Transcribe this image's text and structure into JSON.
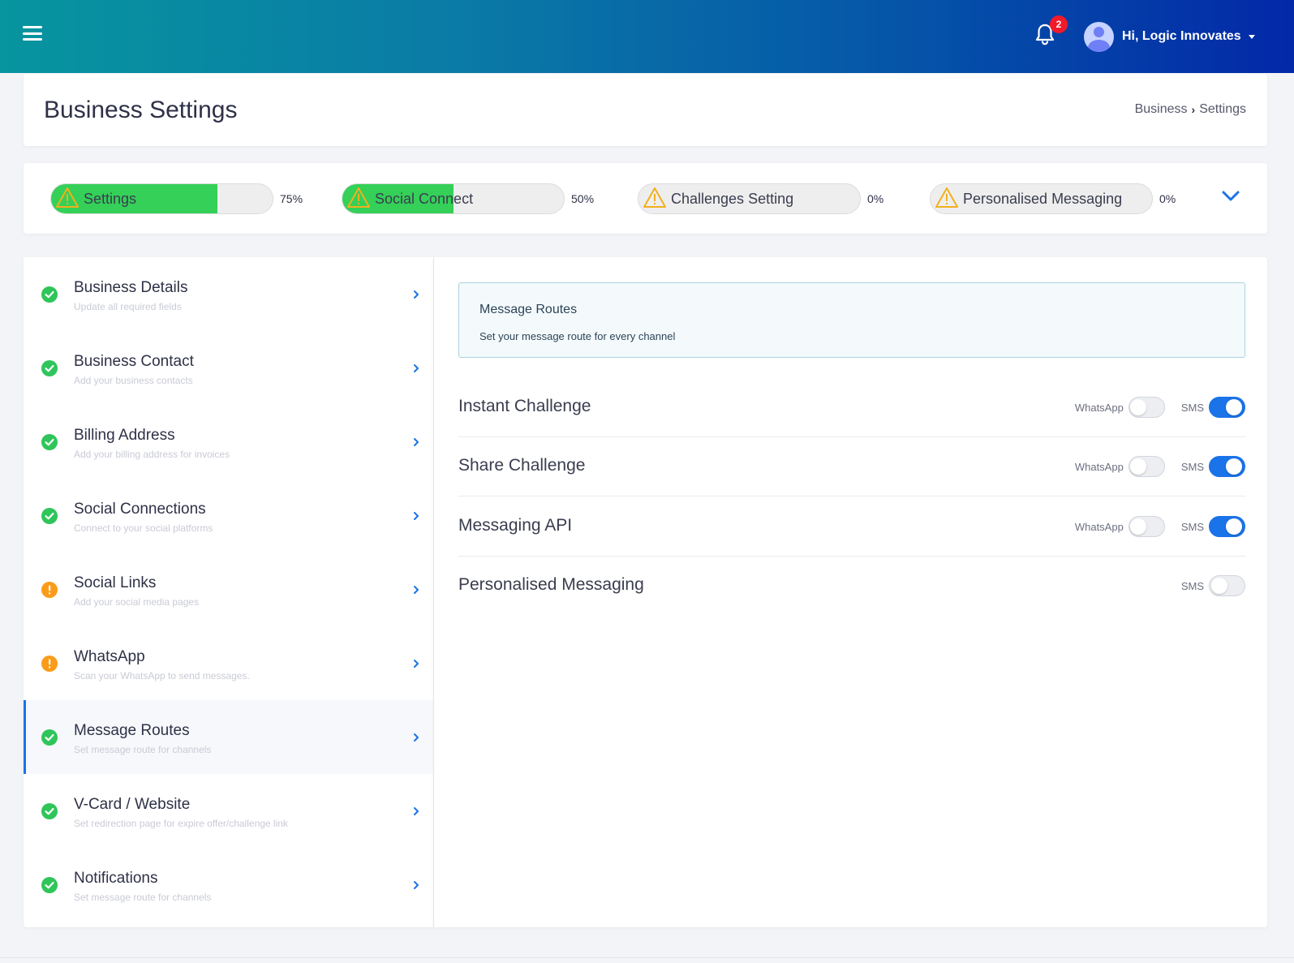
{
  "header": {
    "notification_count": "2",
    "user_greeting": "Hi, Logic Innovates"
  },
  "page": {
    "title": "Business Settings",
    "breadcrumb": [
      "Business",
      "Settings"
    ]
  },
  "progress": [
    {
      "label": "Settings",
      "percent_text": "75%",
      "percent": 75,
      "status": "warning"
    },
    {
      "label": "Social Connect",
      "percent_text": "50%",
      "percent": 50,
      "status": "warning"
    },
    {
      "label": "Challenges Setting",
      "percent_text": "0%",
      "percent": 0,
      "status": "warning"
    },
    {
      "label": "Personalised Messaging",
      "percent_text": "0%",
      "percent": 0,
      "status": "warning"
    }
  ],
  "sidebar": {
    "items": [
      {
        "title": "Business Details",
        "subtitle": "Update all required fields",
        "status": "complete"
      },
      {
        "title": "Business Contact",
        "subtitle": "Add your business contacts",
        "status": "complete"
      },
      {
        "title": "Billing Address",
        "subtitle": "Add your billing address for invoices",
        "status": "complete"
      },
      {
        "title": "Social Connections",
        "subtitle": "Connect to your social platforms",
        "status": "complete"
      },
      {
        "title": "Social Links",
        "subtitle": "Add your social media pages",
        "status": "incomplete"
      },
      {
        "title": "WhatsApp",
        "subtitle": "Scan your WhatsApp to send messages.",
        "status": "incomplete"
      },
      {
        "title": "Message Routes",
        "subtitle": "Set message route for channels",
        "status": "complete"
      },
      {
        "title": "V-Card / Website",
        "subtitle": "Set redirection page for expire offer/challenge link",
        "status": "complete"
      },
      {
        "title": "Notifications",
        "subtitle": "Set message route for channels",
        "status": "complete"
      }
    ]
  },
  "main": {
    "info_title": "Message Routes",
    "info_subtitle": "Set your message route for every channel",
    "routes": [
      {
        "name": "Instant Challenge",
        "whatsapp_label": "WhatsApp",
        "whatsapp_on": false,
        "sms_label": "SMS",
        "sms_on": true
      },
      {
        "name": "Share Challenge",
        "whatsapp_label": "WhatsApp",
        "whatsapp_on": false,
        "sms_label": "SMS",
        "sms_on": true
      },
      {
        "name": "Messaging API",
        "whatsapp_label": "WhatsApp",
        "whatsapp_on": false,
        "sms_label": "SMS",
        "sms_on": true
      },
      {
        "name": "Personalised Messaging",
        "sms_label": "SMS",
        "sms_on": false
      }
    ]
  },
  "colors": {
    "accent": "#1a73e8",
    "progress_fill": "#34d058",
    "complete": "#2fc55a",
    "incomplete": "#fa9c1a",
    "badge": "#f11a2b"
  }
}
